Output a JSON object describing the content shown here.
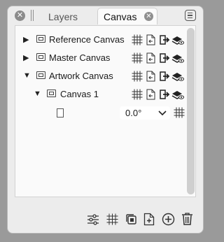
{
  "tabs": {
    "layers": "Layers",
    "canvas": "Canvas"
  },
  "icons": {
    "close": "close-icon",
    "grip": "drag-handle",
    "menu": "panel-menu-icon",
    "expand": "triangle",
    "grid": "grid-icon",
    "doc_add": "document-icon",
    "export": "export-icon",
    "hide": "hide-icon"
  },
  "rows": [
    {
      "label": "Reference Canvas",
      "expanded": false
    },
    {
      "label": "Master Canvas",
      "expanded": false
    },
    {
      "label": "Artwork Canvas",
      "expanded": true
    },
    {
      "label": "Canvas 1",
      "expanded": true
    }
  ],
  "rotation": {
    "value": "0.0°"
  },
  "tree_toggle": {
    "collapsed": "▶",
    "expanded": "▼"
  },
  "close_glyph": "✕"
}
